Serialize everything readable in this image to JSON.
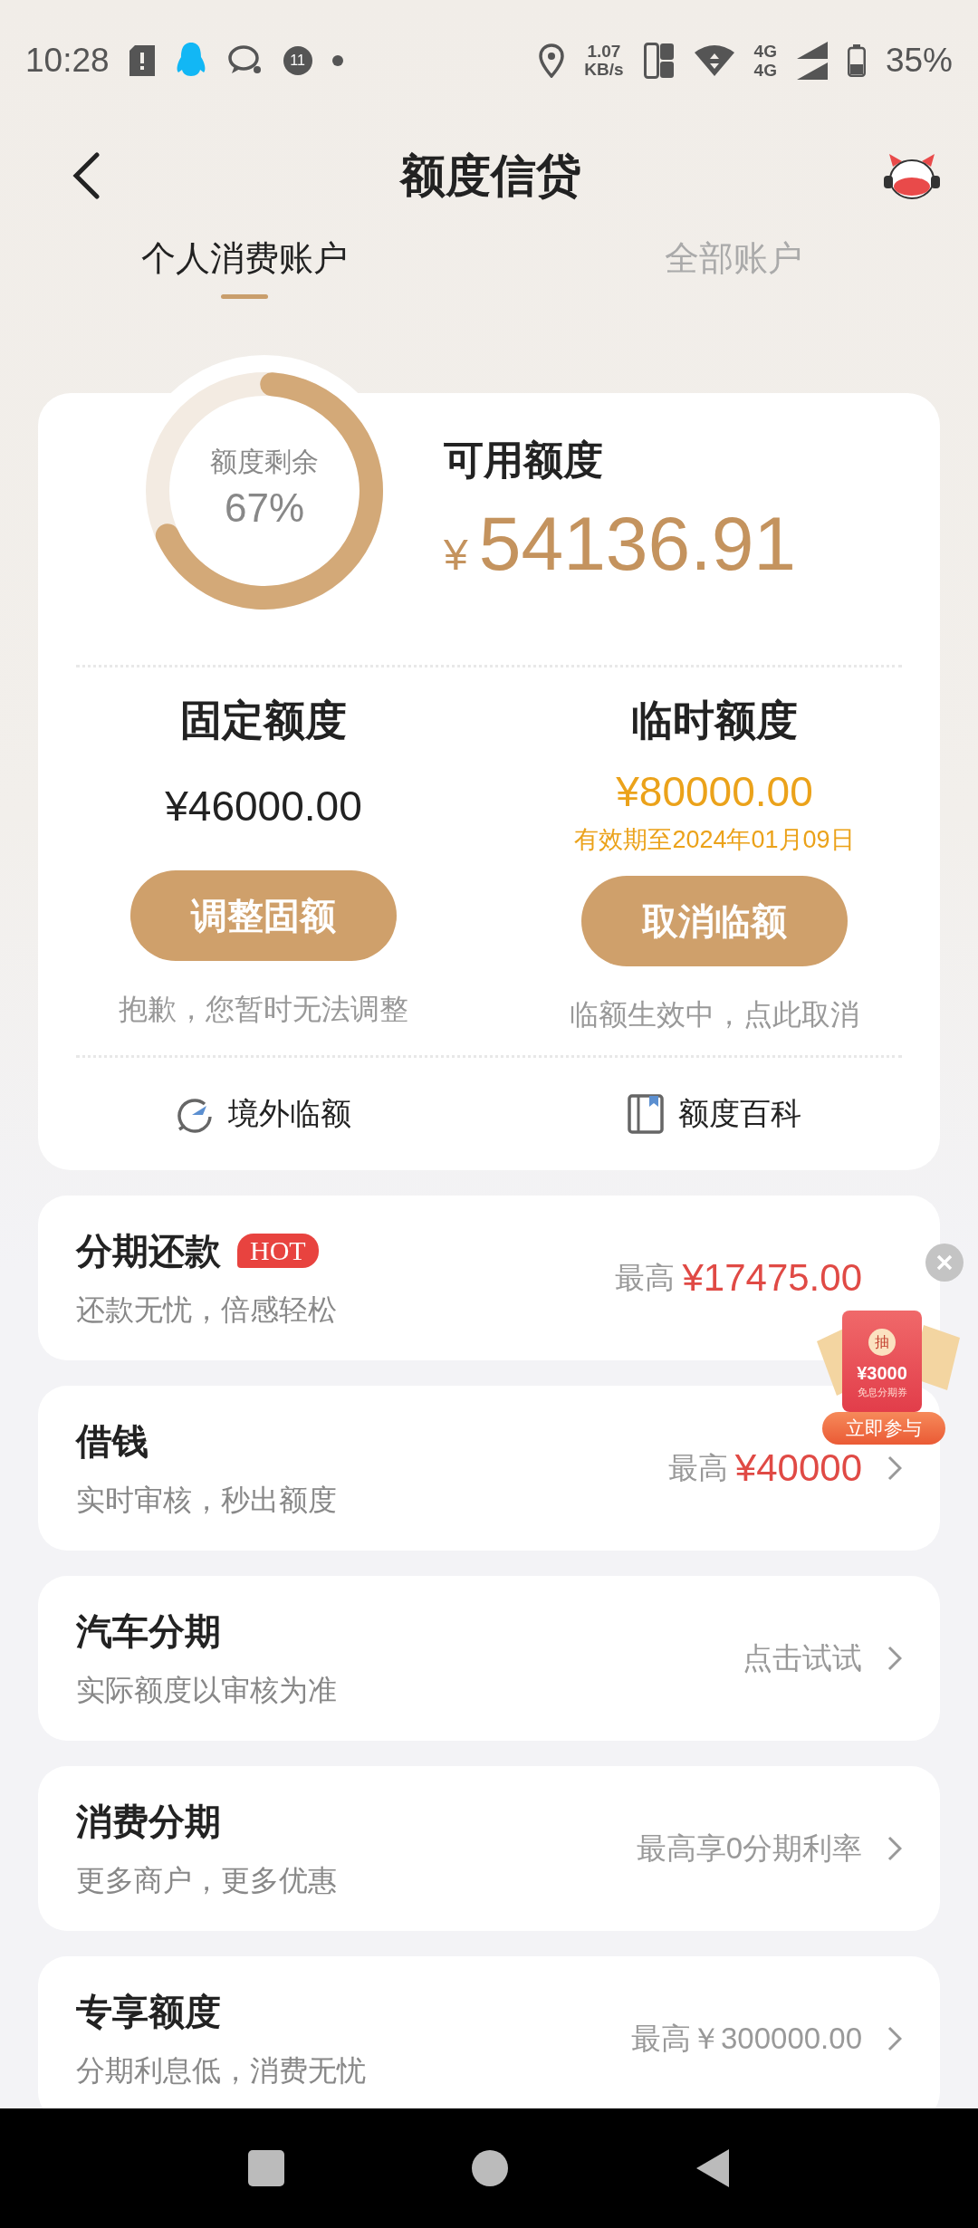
{
  "status_bar": {
    "time": "10:28",
    "notification_count": "11",
    "net_speed": "1.07",
    "net_unit": "KB/s",
    "networks": [
      "4G",
      "4G"
    ],
    "battery": "35%"
  },
  "header": {
    "title": "额度信贷"
  },
  "tabs": [
    {
      "label": "个人消费账户",
      "selected": true
    },
    {
      "label": "全部账户",
      "selected": false
    }
  ],
  "summary": {
    "ring_label": "额度剩余",
    "ring_percent": "67%",
    "level": 0.67,
    "available_label": "可用额度",
    "currency": "¥",
    "available_amount": "54136.91"
  },
  "quotas": [
    {
      "kind": "fixed",
      "title": "固定额度",
      "amount": "¥46000.00",
      "button": "调整固额",
      "note": "抱歉，您暂时无法调整"
    },
    {
      "kind": "temporary",
      "title": "临时额度",
      "amount": "¥80000.00",
      "validity": "有效期至2024年01月09日",
      "button": "取消临额",
      "note": "临额生效中，点此取消"
    }
  ],
  "links": [
    {
      "label": "境外临额"
    },
    {
      "label": "额度百科"
    }
  ],
  "products": [
    {
      "title": "分期还款",
      "badge": "HOT",
      "subtitle": "还款无忧，倍感轻松",
      "kind": "highlight",
      "limit_label": "最高",
      "limit_value": "¥17475.00",
      "chevron": false
    },
    {
      "title": "借钱",
      "subtitle": "实时审核，秒出额度",
      "kind": "highlight",
      "limit_label": "最高",
      "limit_value": "¥40000",
      "chevron": true
    },
    {
      "title": "汽车分期",
      "subtitle": "实际额度以审核为准",
      "kind": "plain",
      "limit_value": "点击试试",
      "chevron": true
    },
    {
      "title": "消费分期",
      "subtitle": "更多商户，更多优惠",
      "kind": "plain",
      "limit_value": "最高享0分期利率",
      "chevron": true
    },
    {
      "title": "专享额度",
      "subtitle": "分期利息低，消费无忧",
      "kind": "plain",
      "limit_value": "最高￥300000.00",
      "chevron": true
    }
  ],
  "promo": {
    "stamp": "抽",
    "amount": "¥3000",
    "caption": "免息分期券",
    "button": "立即参与"
  }
}
